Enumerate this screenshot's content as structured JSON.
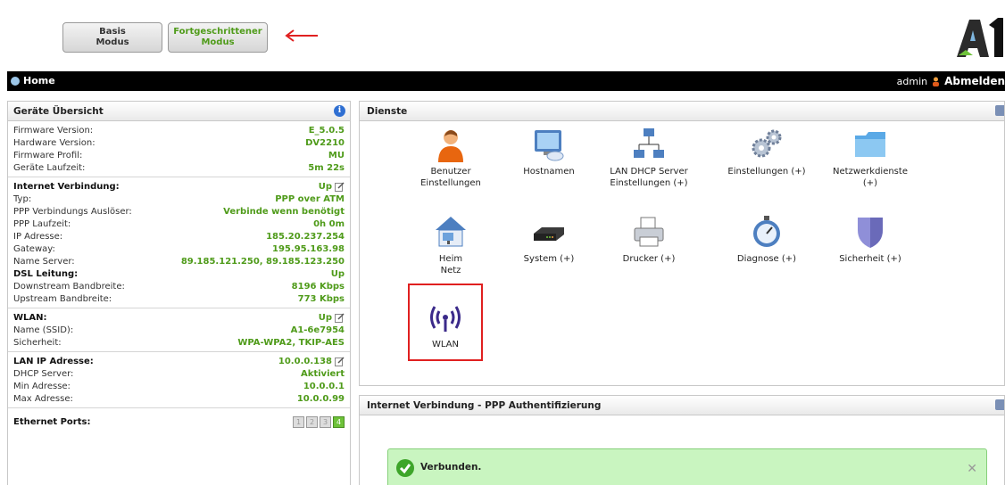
{
  "mode": {
    "basis_line1": "Basis",
    "basis_line2": "Modus",
    "advanced_line1": "Fortgeschrittener",
    "advanced_line2": "Modus"
  },
  "logo": {
    "text": "A1"
  },
  "topbar": {
    "home": "Home",
    "user": "admin",
    "logout": "Abmelden"
  },
  "overview": {
    "title": "Geräte Übersicht",
    "info_icon": "i",
    "device": [
      {
        "k": "Firmware Version:",
        "v": "E_5.0.5"
      },
      {
        "k": "Hardware Version:",
        "v": "DV2210"
      },
      {
        "k": "Firmware Profil:",
        "v": "MU"
      },
      {
        "k": "Geräte Laufzeit:",
        "v": "5m 22s"
      }
    ],
    "internet": {
      "label": "Internet Verbindung:",
      "status": "Up",
      "rows": [
        {
          "k": "Typ:",
          "v": "PPP over ATM"
        },
        {
          "k": "PPP Verbindungs Auslöser:",
          "v": "Verbinde wenn benötigt"
        },
        {
          "k": "PPP Laufzeit:",
          "v": "0h 0m"
        },
        {
          "k": "IP Adresse:",
          "v": "185.20.237.254"
        },
        {
          "k": "Gateway:",
          "v": "195.95.163.98"
        },
        {
          "k": "Name Server:",
          "v": "89.185.121.250, 89.185.123.250"
        }
      ],
      "dsl_label": "DSL Leitung:",
      "dsl_status": "Up",
      "dsl_rows": [
        {
          "k": "Downstream Bandbreite:",
          "v": "8196 Kbps"
        },
        {
          "k": "Upstream Bandbreite:",
          "v": "773 Kbps"
        }
      ]
    },
    "wlan": {
      "label": "WLAN:",
      "status": "Up",
      "rows": [
        {
          "k": "Name (SSID):",
          "v": "A1-6e7954"
        },
        {
          "k": "Sicherheit:",
          "v": "WPA-WPA2, TKIP-AES"
        }
      ]
    },
    "lan": {
      "label": "LAN IP Adresse:",
      "value": "10.0.0.138",
      "rows": [
        {
          "k": "DHCP Server:",
          "v": "Aktiviert"
        },
        {
          "k": "Min Adresse:",
          "v": "10.0.0.1"
        },
        {
          "k": "Max Adresse:",
          "v": "10.0.0.99"
        }
      ]
    },
    "ethernet": {
      "label": "Ethernet Ports:",
      "ports": [
        "1",
        "2",
        "3",
        "4"
      ],
      "active_port": "4"
    }
  },
  "dienste": {
    "title": "Dienste",
    "items": [
      {
        "line1": "Benutzer",
        "line2": "Einstellungen",
        "icon": "user-icon"
      },
      {
        "line1": "Hostnamen",
        "line2": "",
        "icon": "monitor-icon"
      },
      {
        "line1": "LAN DHCP Server",
        "line2": "Einstellungen (+)",
        "icon": "network-icon"
      },
      {
        "line1": "Einstellungen (+)",
        "line2": "",
        "icon": "gears-icon"
      },
      {
        "line1": "Netzwerkdienste",
        "line2": "(+)",
        "icon": "folder-icon"
      },
      {
        "line1": "Heim",
        "line2": "Netz",
        "icon": "home-network-icon"
      },
      {
        "line1": "System (+)",
        "line2": "",
        "icon": "router-icon"
      },
      {
        "line1": "Drucker (+)",
        "line2": "",
        "icon": "printer-icon"
      },
      {
        "line1": "Diagnose (+)",
        "line2": "",
        "icon": "stopwatch-icon"
      },
      {
        "line1": "Sicherheit (+)",
        "line2": "",
        "icon": "shield-icon"
      },
      {
        "line1": "WLAN",
        "line2": "",
        "icon": "wlan-icon"
      }
    ]
  },
  "internet_panel": {
    "title": "Internet Verbindung - PPP Authentifizierung",
    "message": "Verbunden.",
    "close": "✕"
  },
  "colors": {
    "value_green": "#4f9b1a",
    "success_bg": "#c9f5c0",
    "highlight_red": "#e02020"
  }
}
